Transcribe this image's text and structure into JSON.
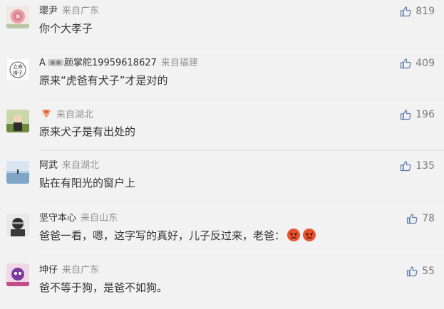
{
  "comments": [
    {
      "user": "璎尹",
      "from": "来自广东",
      "text": "你个大孝子",
      "likes": "819"
    },
    {
      "user": "A",
      "user_suffix": "颜掌舵19959618627",
      "from": "来自福建",
      "text": "原来“虎爸有犬子”才是对的",
      "likes": "409"
    },
    {
      "user": "",
      "from": "来自湖北",
      "text": "原来犬子是有出处的",
      "likes": "196"
    },
    {
      "user": "阿武",
      "from": "来自湖北",
      "text": "贴在有阳光的窗户上",
      "likes": "135"
    },
    {
      "user": "坚守本心",
      "from": "来自山东",
      "text": "爸爸一看，嗯，这字写的真好，儿子反过来，老爸：",
      "likes": "78"
    },
    {
      "user": "坤仔",
      "from": "来自广东",
      "text": "爸不等于狗，是爸不如狗。",
      "likes": "55"
    }
  ],
  "icons": {
    "like": "thumbs-up-icon",
    "angry": "angry-face-icon"
  },
  "colors": {
    "background": "#f2f2f2",
    "text": "#333333",
    "meta": "#939393",
    "like_icon": "#5b7ba8",
    "angry": "#e8532f"
  }
}
